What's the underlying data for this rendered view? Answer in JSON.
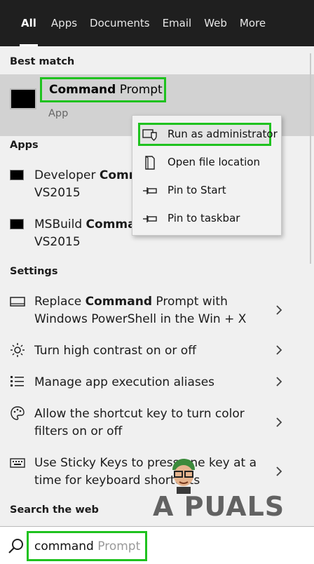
{
  "tabs": [
    {
      "label": "All",
      "active": true
    },
    {
      "label": "Apps"
    },
    {
      "label": "Documents"
    },
    {
      "label": "Email"
    },
    {
      "label": "Web"
    },
    {
      "label": "More"
    }
  ],
  "best_match": {
    "heading": "Best match",
    "title_bold": "Command",
    "title_rest": " Prompt",
    "subtitle": "App"
  },
  "apps": {
    "heading": "Apps",
    "items": [
      {
        "line1_pre": "Developer ",
        "line1_bold": "Comm",
        "line2": "VS2015"
      },
      {
        "line1_pre": "MSBuild ",
        "line1_bold": "Comma",
        "line2": "VS2015"
      }
    ]
  },
  "context_menu": {
    "items": [
      {
        "label": "Run as administrator",
        "icon": "shield-icon"
      },
      {
        "label": "Open file location",
        "icon": "file-icon"
      },
      {
        "label": "Pin to Start",
        "icon": "pin-icon"
      },
      {
        "label": "Pin to taskbar",
        "icon": "pin-icon"
      }
    ]
  },
  "settings": {
    "heading": "Settings",
    "items": [
      {
        "l1_pre": "Replace ",
        "l1_bold": "Command",
        "l1_post": " Prompt with",
        "line2": "Windows PowerShell in the Win + X",
        "icon": "monitor-icon"
      },
      {
        "line1": "Turn high contrast on or off",
        "icon": "sun-icon"
      },
      {
        "line1": "Manage app execution aliases",
        "icon": "list-icon"
      },
      {
        "line1": "Allow the shortcut key to turn color",
        "line2": "filters on or off",
        "icon": "palette-icon"
      },
      {
        "line1": "Use Sticky Keys to press one key at a",
        "line2": "time for keyboard shortcuts",
        "icon": "keyboard-icon"
      }
    ]
  },
  "search_web": {
    "heading": "Search the web"
  },
  "search": {
    "typed": "command",
    "suggestion": " Prompt"
  },
  "watermark": {
    "text": "A PUALS"
  },
  "colors": {
    "highlight": "#1fc21f",
    "tabbar": "#1f1f1f"
  }
}
